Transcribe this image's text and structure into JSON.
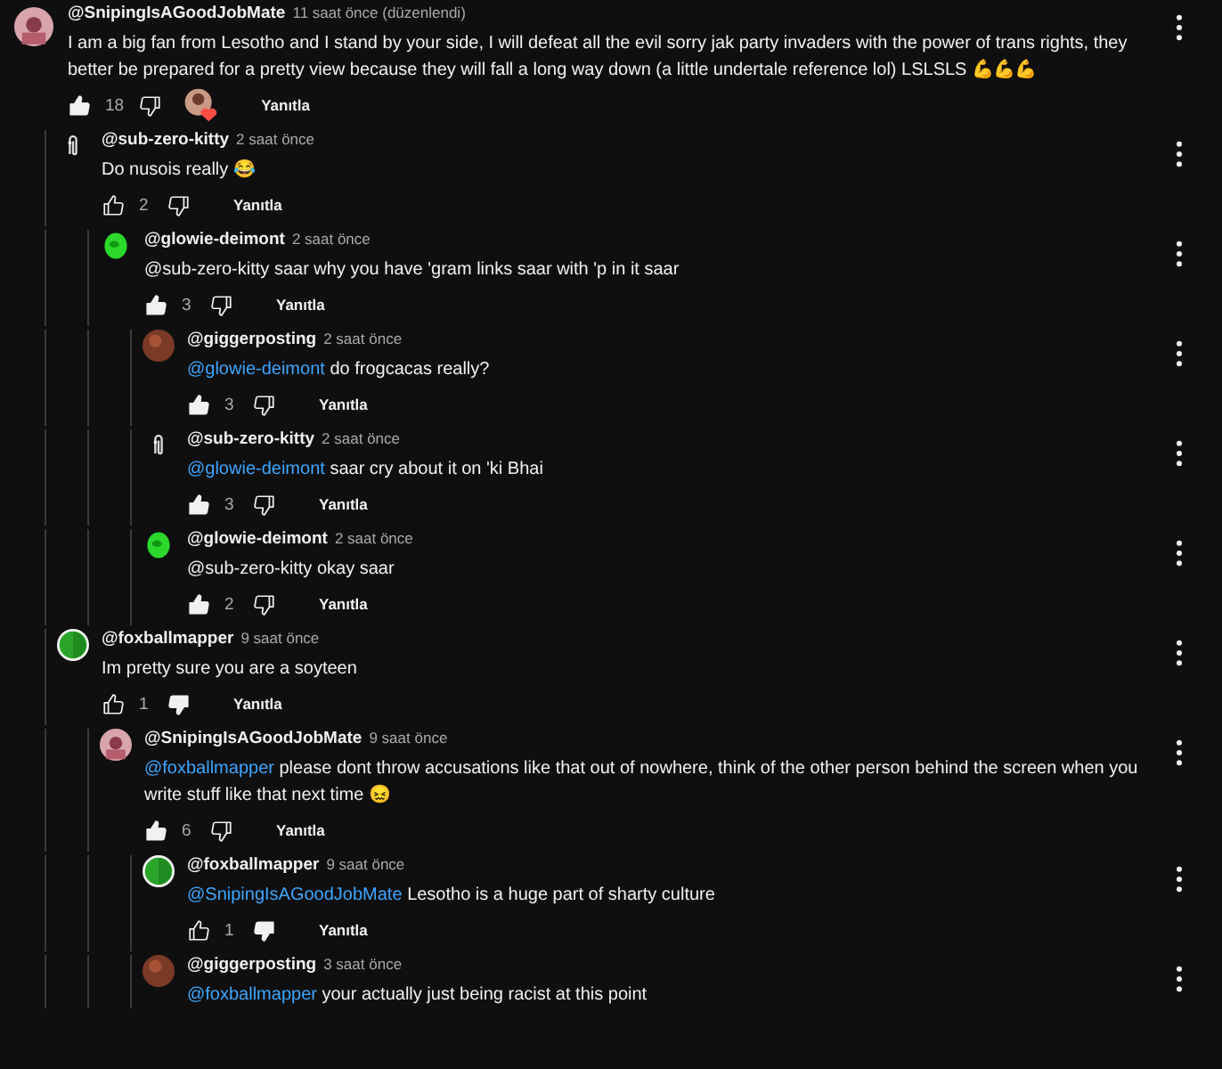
{
  "comments": [
    {
      "author": "@SnipingIsAGoodJobMate",
      "time": "11 saat önce (düzenlendi)",
      "avatar": {
        "kind": "portrait"
      },
      "text": "I am a big fan from Lesotho and I stand by your side, I will defeat all the evil sorry jak party invaders with the power of trans rights, they better be prepared for a pretty view because they will fall a long way down (a little undertale reference lol) LSLSLS 💪💪💪",
      "likes": "18",
      "liked": true,
      "disliked": false,
      "creator_heart": true,
      "reply_label": "Yanıtla",
      "children": [
        {
          "author": "@sub-zero-kitty",
          "time": "2 saat önce",
          "avatar": {
            "kind": "paperclip"
          },
          "text": "Do nusois really 😂",
          "likes": "2",
          "liked": false,
          "disliked": false,
          "reply_label": "Yanıtla",
          "children": [
            {
              "author": "@glowie-deimont",
              "time": "2 saat önce",
              "avatar": {
                "kind": "green-head"
              },
              "text": "@sub-zero-kitty saar why you have 'gram links saar with 'p in it saar",
              "likes": "3",
              "liked": true,
              "disliked": false,
              "reply_label": "Yanıtla",
              "children": [
                {
                  "author": "@giggerposting",
                  "time": "2 saat önce",
                  "avatar": {
                    "kind": "brown"
                  },
                  "mention": "@glowie-deimont",
                  "text": "do frogcacas really?",
                  "likes": "3",
                  "liked": true,
                  "disliked": false,
                  "reply_label": "Yanıtla"
                },
                {
                  "author": "@sub-zero-kitty",
                  "time": "2 saat önce",
                  "avatar": {
                    "kind": "paperclip"
                  },
                  "mention": "@glowie-deimont",
                  "text": "saar cry about it on 'ki Bhai",
                  "likes": "3",
                  "liked": true,
                  "disliked": false,
                  "reply_label": "Yanıtla"
                },
                {
                  "author": "@glowie-deimont",
                  "time": "2 saat önce",
                  "avatar": {
                    "kind": "green-head"
                  },
                  "text": "@sub-zero-kitty okay saar",
                  "likes": "2",
                  "liked": true,
                  "disliked": false,
                  "reply_label": "Yanıtla"
                }
              ]
            }
          ]
        },
        {
          "author": "@foxballmapper",
          "time": "9 saat önce",
          "avatar": {
            "kind": "balloon"
          },
          "text": "Im pretty sure you are a soyteen",
          "likes": "1",
          "liked": false,
          "disliked": true,
          "reply_label": "Yanıtla",
          "children": [
            {
              "author": "@SnipingIsAGoodJobMate",
              "time": "9 saat önce",
              "avatar": {
                "kind": "portrait"
              },
              "mention": "@foxballmapper",
              "text": "please dont throw accusations like that out of nowhere, think of the other person behind the screen when you write stuff like that next time 😖",
              "likes": "6",
              "liked": true,
              "disliked": false,
              "reply_label": "Yanıtla",
              "children": [
                {
                  "author": "@foxballmapper",
                  "time": "9 saat önce",
                  "avatar": {
                    "kind": "balloon"
                  },
                  "mention": "@SnipingIsAGoodJobMate",
                  "text": "Lesotho is a huge part of sharty culture",
                  "likes": "1",
                  "liked": false,
                  "disliked": true,
                  "reply_label": "Yanıtla"
                },
                {
                  "author": "@giggerposting",
                  "time": "3 saat önce",
                  "avatar": {
                    "kind": "brown"
                  },
                  "mention": "@foxballmapper",
                  "text": "your actually just being racist at this point"
                }
              ]
            }
          ]
        }
      ]
    }
  ]
}
